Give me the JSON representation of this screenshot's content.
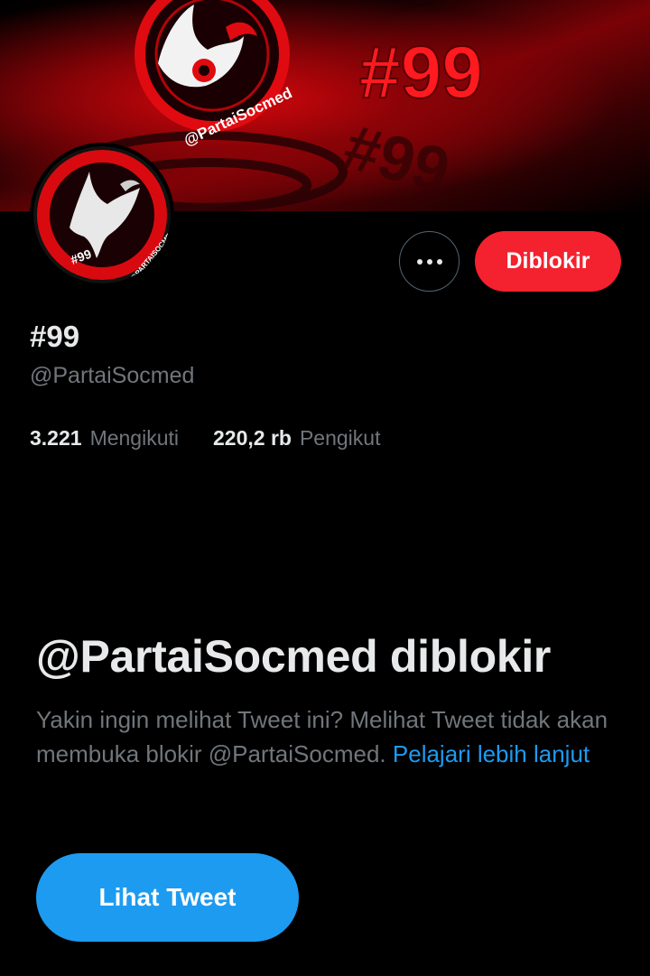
{
  "banner": {
    "hashtag": "#99",
    "logo_text": "@PartaiSocmed"
  },
  "avatar": {
    "ring_text": "@PARTAISOCMED",
    "tag": "#99"
  },
  "actions": {
    "more_icon": "more-horizontal-icon",
    "blocked_label": "Diblokir"
  },
  "profile": {
    "display_name": "#99",
    "handle": "@PartaiSocmed"
  },
  "stats": {
    "following_count": "3.221",
    "following_label": "Mengikuti",
    "followers_count": "220,2 rb",
    "followers_label": "Pengikut"
  },
  "blocked_notice": {
    "title": "@PartaiSocmed diblokir",
    "description": "Yakin ingin melihat Tweet ini? Melihat Tweet tidak akan membuka blokir @PartaiSocmed.",
    "link_text": "Pelajari lebih lanjut",
    "button_label": "Lihat Tweet"
  },
  "colors": {
    "accent_blue": "#1d9bf0",
    "blocked_red": "#f4212e",
    "background": "#000000",
    "secondary_text": "#71767b"
  }
}
